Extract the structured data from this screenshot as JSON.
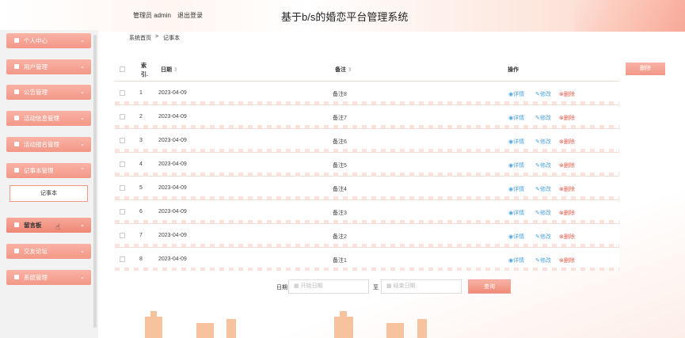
{
  "header": {
    "admin_label": "管理员 admin",
    "logout_label": "退出登录",
    "title": "基于b/s的婚恋平台管理系统"
  },
  "breadcrumb": {
    "home": "系统首页",
    "separator": ">",
    "current": "记事本"
  },
  "sidebar": {
    "items": [
      {
        "label": "个人中心",
        "icon": "user-icon"
      },
      {
        "label": "用户管理",
        "icon": "briefcase-icon"
      },
      {
        "label": "公告管理",
        "icon": "send-icon"
      },
      {
        "label": "活动信息管理",
        "icon": "grid-icon"
      },
      {
        "label": "活动报名管理",
        "icon": "grid-icon"
      },
      {
        "label": "记事本管理",
        "icon": "grid-icon"
      },
      {
        "label": "留言板",
        "icon": "grid-icon"
      },
      {
        "label": "交友论坛",
        "icon": "book-icon"
      },
      {
        "label": "系统管理",
        "icon": "list-icon"
      }
    ],
    "sub_item": "记事本"
  },
  "table": {
    "headers": {
      "index_line1": "索",
      "index_line2": "引.",
      "date": "日期",
      "note": "备注",
      "actions": "操作"
    },
    "sort_icon": "⇕",
    "delete_all_label": "删除",
    "rows": [
      {
        "index": "1",
        "date": "2023-04-09",
        "note": "备注8"
      },
      {
        "index": "2",
        "date": "2023-04-09",
        "note": "备注7"
      },
      {
        "index": "3",
        "date": "2023-04-09",
        "note": "备注6"
      },
      {
        "index": "4",
        "date": "2023-04-09",
        "note": "备注5"
      },
      {
        "index": "5",
        "date": "2023-04-09",
        "note": "备注4"
      },
      {
        "index": "6",
        "date": "2023-04-09",
        "note": "备注3"
      },
      {
        "index": "7",
        "date": "2023-04-09",
        "note": "备注2"
      },
      {
        "index": "8",
        "date": "2023-04-09",
        "note": "备注1"
      }
    ],
    "actions": {
      "detail": "详情",
      "edit": "修改",
      "delete": "删除"
    }
  },
  "search": {
    "date_label": "日期",
    "start_placeholder": "开始日期",
    "to_label": "至",
    "end_placeholder": "结束日期",
    "search_button": "查询"
  },
  "colors": {
    "accent": "#f39888",
    "link": "#4aa3df",
    "danger": "#e05b4b"
  }
}
